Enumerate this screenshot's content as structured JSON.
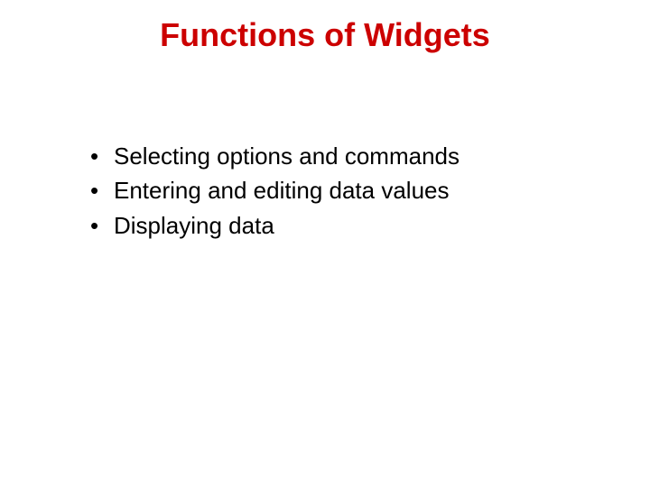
{
  "slide": {
    "title": "Functions of Widgets",
    "bullets": [
      "Selecting options and commands",
      "Entering and editing data values",
      "Displaying data"
    ]
  }
}
